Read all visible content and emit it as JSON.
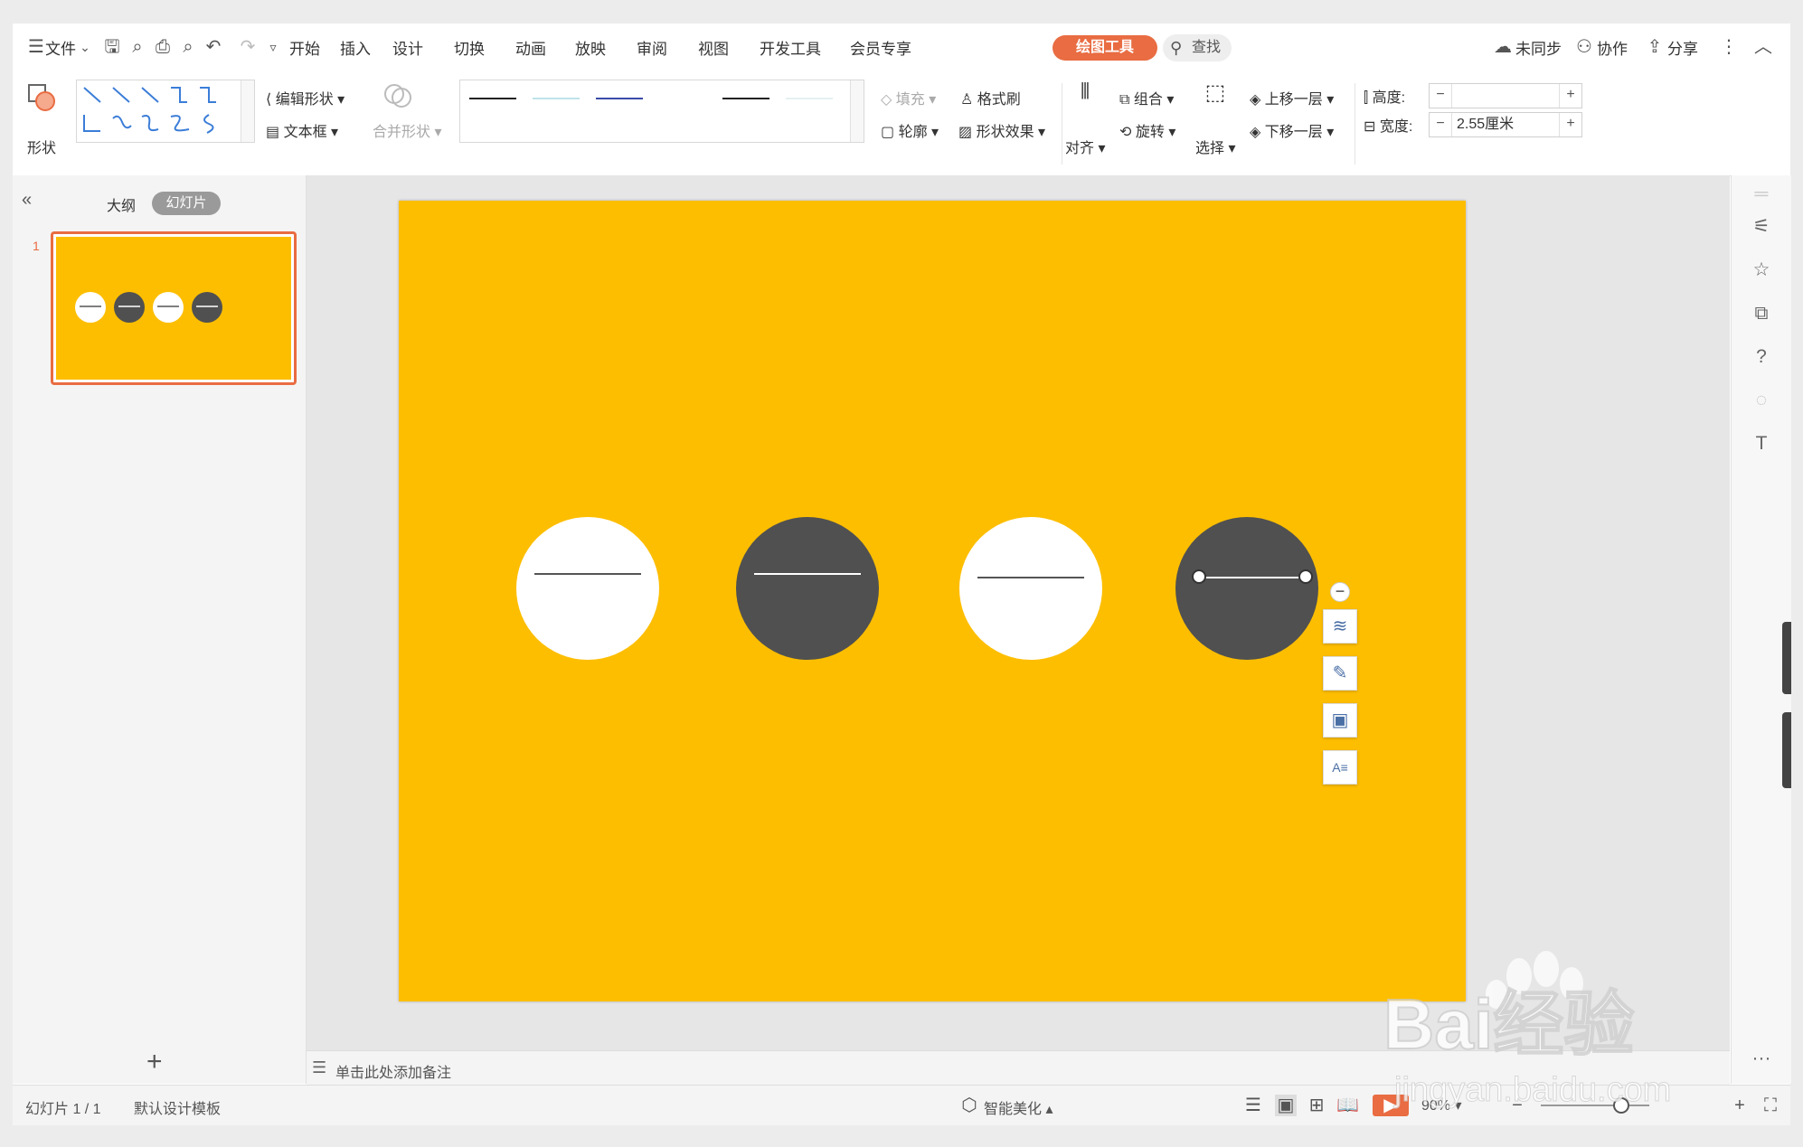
{
  "menu": {
    "file": "文件",
    "tabs": [
      "开始",
      "插入",
      "设计",
      "切换",
      "动画",
      "放映",
      "审阅",
      "视图",
      "开发工具",
      "会员专享"
    ],
    "active_tab": "绘图工具",
    "search": "查找",
    "right": {
      "unsync": "未同步",
      "collab": "协作",
      "share": "分享"
    }
  },
  "ribbon": {
    "shape": "形状",
    "edit_shape": "编辑形状",
    "text_box": "文本框",
    "merge_shape": "合并形状",
    "fill": "填充",
    "format_brush": "格式刷",
    "outline": "轮廓",
    "shape_effect": "形状效果",
    "align": "对齐",
    "group": "组合",
    "rotate": "旋转",
    "select": "选择",
    "bring_forward": "上移一层",
    "send_backward": "下移一层",
    "height_label": "高度:",
    "height_value": "",
    "width_label": "宽度:",
    "width_value": "2.55厘米",
    "minus": "−",
    "plus": "+"
  },
  "left_pane": {
    "outline_tab": "大纲",
    "slides_tab": "幻灯片",
    "slide_number": "1",
    "add": "+"
  },
  "notes": {
    "placeholder": "单击此处添加备注"
  },
  "status": {
    "slide_info": "幻灯片 1 / 1",
    "template": "默认设计模板",
    "smart": "智能美化",
    "zoom": "90%"
  },
  "watermark": {
    "text": "Bai经验",
    "url": "jingyan.baidu.com"
  },
  "colors": {
    "slide_bg": "#fdbe00",
    "dark_circle": "#505050",
    "accent": "#e96c42"
  }
}
